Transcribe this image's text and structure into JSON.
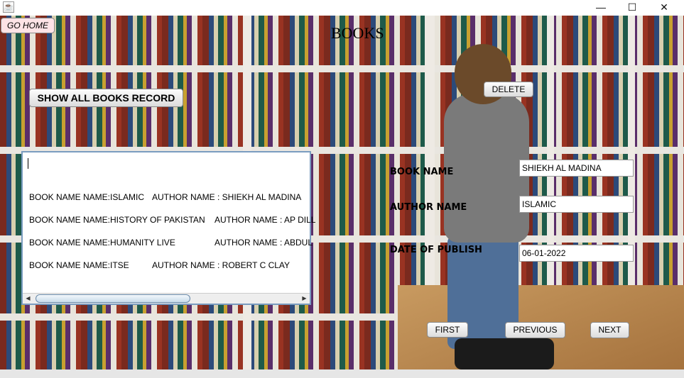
{
  "window": {
    "icon": "java-icon",
    "minimize": "—",
    "maximize": "☐",
    "close": "✕"
  },
  "buttons": {
    "go_home": "GO HOME",
    "show_all": "SHOW ALL BOOKS RECORD",
    "delete": "DELETE",
    "first": "FIRST",
    "previous": "PREVIOUS",
    "next": "NEXT"
  },
  "title": "BOOKS",
  "form": {
    "book_name_label": "BOOK NAME",
    "book_name_value": "SHIEKH AL MADINA",
    "author_name_label": "AUTHOR NAME",
    "author_name_value": "ISLAMIC",
    "date_label": "DATE OF PUBLISH",
    "date_value": "06-01-2022"
  },
  "records": [
    {
      "book": "BOOK NAME NAME:ISLAMIC",
      "author": "AUTHOR NAME : SHIEKH AL MADINA"
    },
    {
      "book": "BOOK NAME NAME:HISTORY OF PAKISTAN",
      "author": "AUTHOR NAME : AP DILL"
    },
    {
      "book": "BOOK NAME NAME:HUMANITY LIVE",
      "author": "AUTHOR NAME : ABDUL"
    },
    {
      "book": "BOOK NAME NAME:ITSE",
      "author": "AUTHOR NAME : ROBERT C CLAY"
    }
  ]
}
